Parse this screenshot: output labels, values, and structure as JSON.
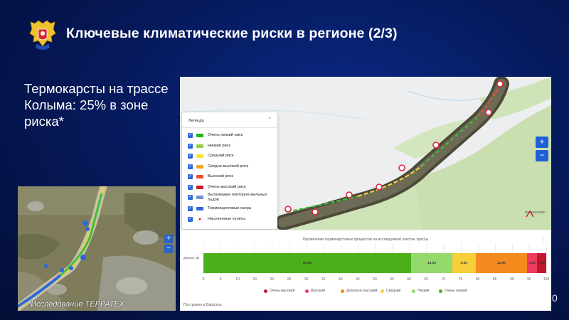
{
  "slide": {
    "title": "Ключевые климатические риски в регионе (2/3)",
    "headline": "Термокарсты на трассе Колыма: 25% в зоне риска*",
    "page_number": "0",
    "emblem_icon": "coat-of-arms-icon"
  },
  "satellite": {
    "caption": "*Исследование ТЕРРАТЕХ",
    "zoom_in": "+",
    "zoom_out": "−"
  },
  "map": {
    "legend_title": "Легенда",
    "legend_items": [
      {
        "label": "Очень низкий риск",
        "color": "#1fb31f",
        "checked": true
      },
      {
        "label": "Низкий риск",
        "color": "#8fd14f",
        "checked": true
      },
      {
        "label": "Средний риск",
        "color": "#f5e23c",
        "checked": true
      },
      {
        "label": "Средне-высокий риск",
        "color": "#f5a623",
        "checked": true
      },
      {
        "label": "Высокий риск",
        "color": "#ef4b33",
        "checked": true
      },
      {
        "label": "Очень высокий риск",
        "color": "#c51c2a",
        "checked": true
      },
      {
        "label": "Вытаивание повторно-жильных льдов",
        "color": "#6b8fd6",
        "checked": true
      },
      {
        "label": "Термокарстовые озера",
        "color": "#2f68d6",
        "checked": true
      },
      {
        "label": "Населенные пункты",
        "color": "#d7263d",
        "checked": true
      }
    ],
    "zoom_in": "+",
    "zoom_out": "−",
    "brand": "РОСКОСМОС"
  },
  "chart_data": {
    "type": "bar",
    "title": "Проявления термокарстовых процессов на исследуемом участке трассы",
    "ylabel": "Длина, км",
    "xlim": [
      0,
      100
    ],
    "x_ticks": [
      "0",
      "5",
      "10",
      "15",
      "20",
      "25",
      "30",
      "35",
      "40",
      "45",
      "50",
      "55",
      "60",
      "65",
      "70",
      "75",
      "80",
      "85",
      "90",
      "95",
      "100"
    ],
    "stacked": true,
    "segments": [
      {
        "name": "Очень низкий",
        "value": 60.6,
        "label": "60,60",
        "color": "#4caf1a"
      },
      {
        "name": "Низкий",
        "value": 12.0,
        "label": "10,00",
        "color": "#93d96b"
      },
      {
        "name": "Средний",
        "value": 6.8,
        "label": "5,40",
        "color": "#f6cf3a"
      },
      {
        "name": "Довольно высокий",
        "value": 15.0,
        "label": "12,90",
        "color": "#f58a1f"
      },
      {
        "name": "Высокий",
        "value": 3.0,
        "label": "1,90",
        "color": "#ef3a5d"
      },
      {
        "name": "Очень высокий",
        "value": 2.6,
        "label": "2,00",
        "color": "#c0182e"
      }
    ],
    "legend": [
      {
        "name": "Очень высокий",
        "color": "#c0182e"
      },
      {
        "name": "Высокий",
        "color": "#ef3a5d"
      },
      {
        "name": "Довольно высокий",
        "color": "#f58a1f"
      },
      {
        "name": "Средний",
        "color": "#f6cf3a"
      },
      {
        "name": "Низкий",
        "color": "#93d96b"
      },
      {
        "name": "Очень низкий",
        "color": "#4caf1a"
      }
    ],
    "footer": "Построено в DataLens"
  }
}
